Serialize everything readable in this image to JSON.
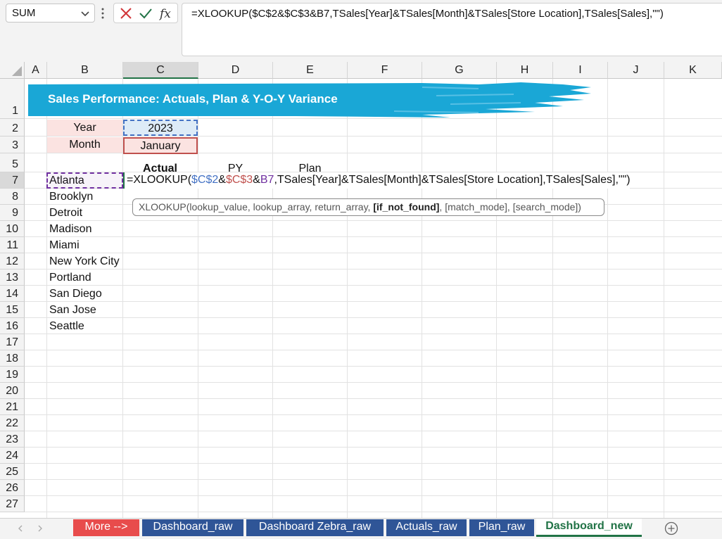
{
  "name_box": {
    "value": "SUM"
  },
  "formula_bar": {
    "formula": "=XLOOKUP($C$2&$C$3&B7,TSales[Year]&TSales[Month]&TSales[Store Location],TSales[Sales],\"\")"
  },
  "columns": [
    "A",
    "B",
    "C",
    "D",
    "E",
    "F",
    "G",
    "H",
    "I",
    "J",
    "K"
  ],
  "rows": [
    "1",
    "2",
    "3",
    "5",
    "7",
    "8",
    "9",
    "10",
    "11",
    "12",
    "13",
    "14",
    "15",
    "16",
    "17",
    "18",
    "19",
    "20",
    "21",
    "22",
    "23",
    "24",
    "25",
    "26",
    "27"
  ],
  "sheet": {
    "title": "Sales Performance: Actuals, Plan & Y-O-Y Variance",
    "year_label": "Year",
    "year_value": "2023",
    "month_label": "Month",
    "month_value": "January",
    "headers": {
      "actual": "Actual",
      "py": "PY",
      "plan": "Plan"
    },
    "cities": [
      "Atlanta",
      "Brooklyn",
      "Detroit",
      "Madison",
      "Miami",
      "New York City",
      "Portland",
      "San Diego",
      "San Jose",
      "Seattle"
    ],
    "edit_formula": {
      "prefix": "=XLOOKUP(",
      "ref1": "$C$2",
      "amp1": "&",
      "ref2": "$C$3",
      "amp2": "&",
      "ref3": "B7",
      "rest": ",TSales[Year]&TSales[Month]&TSales[Store Location],TSales[Sales],\"\")"
    },
    "tooltip": {
      "before": "XLOOKUP(lookup_value, lookup_array, return_array, ",
      "bold": "[if_not_found]",
      "after": ", [match_mode], [search_mode])"
    }
  },
  "tabs": [
    {
      "label": "More -->",
      "color": "#e84c4c"
    },
    {
      "label": "Dashboard_raw",
      "color": "#2f5597"
    },
    {
      "label": "Dashboard Zebra_raw",
      "color": "#2f5597"
    },
    {
      "label": "Actuals_raw",
      "color": "#2f5597"
    },
    {
      "label": "Plan_raw",
      "color": "#2f5597"
    },
    {
      "label": "Dashboard_new",
      "color": "#217346"
    }
  ],
  "colors": {
    "accent": "#217346",
    "banner": "#1aa7d6",
    "label_fill": "#fbe3e1",
    "year_fill": "#ddebf7"
  }
}
